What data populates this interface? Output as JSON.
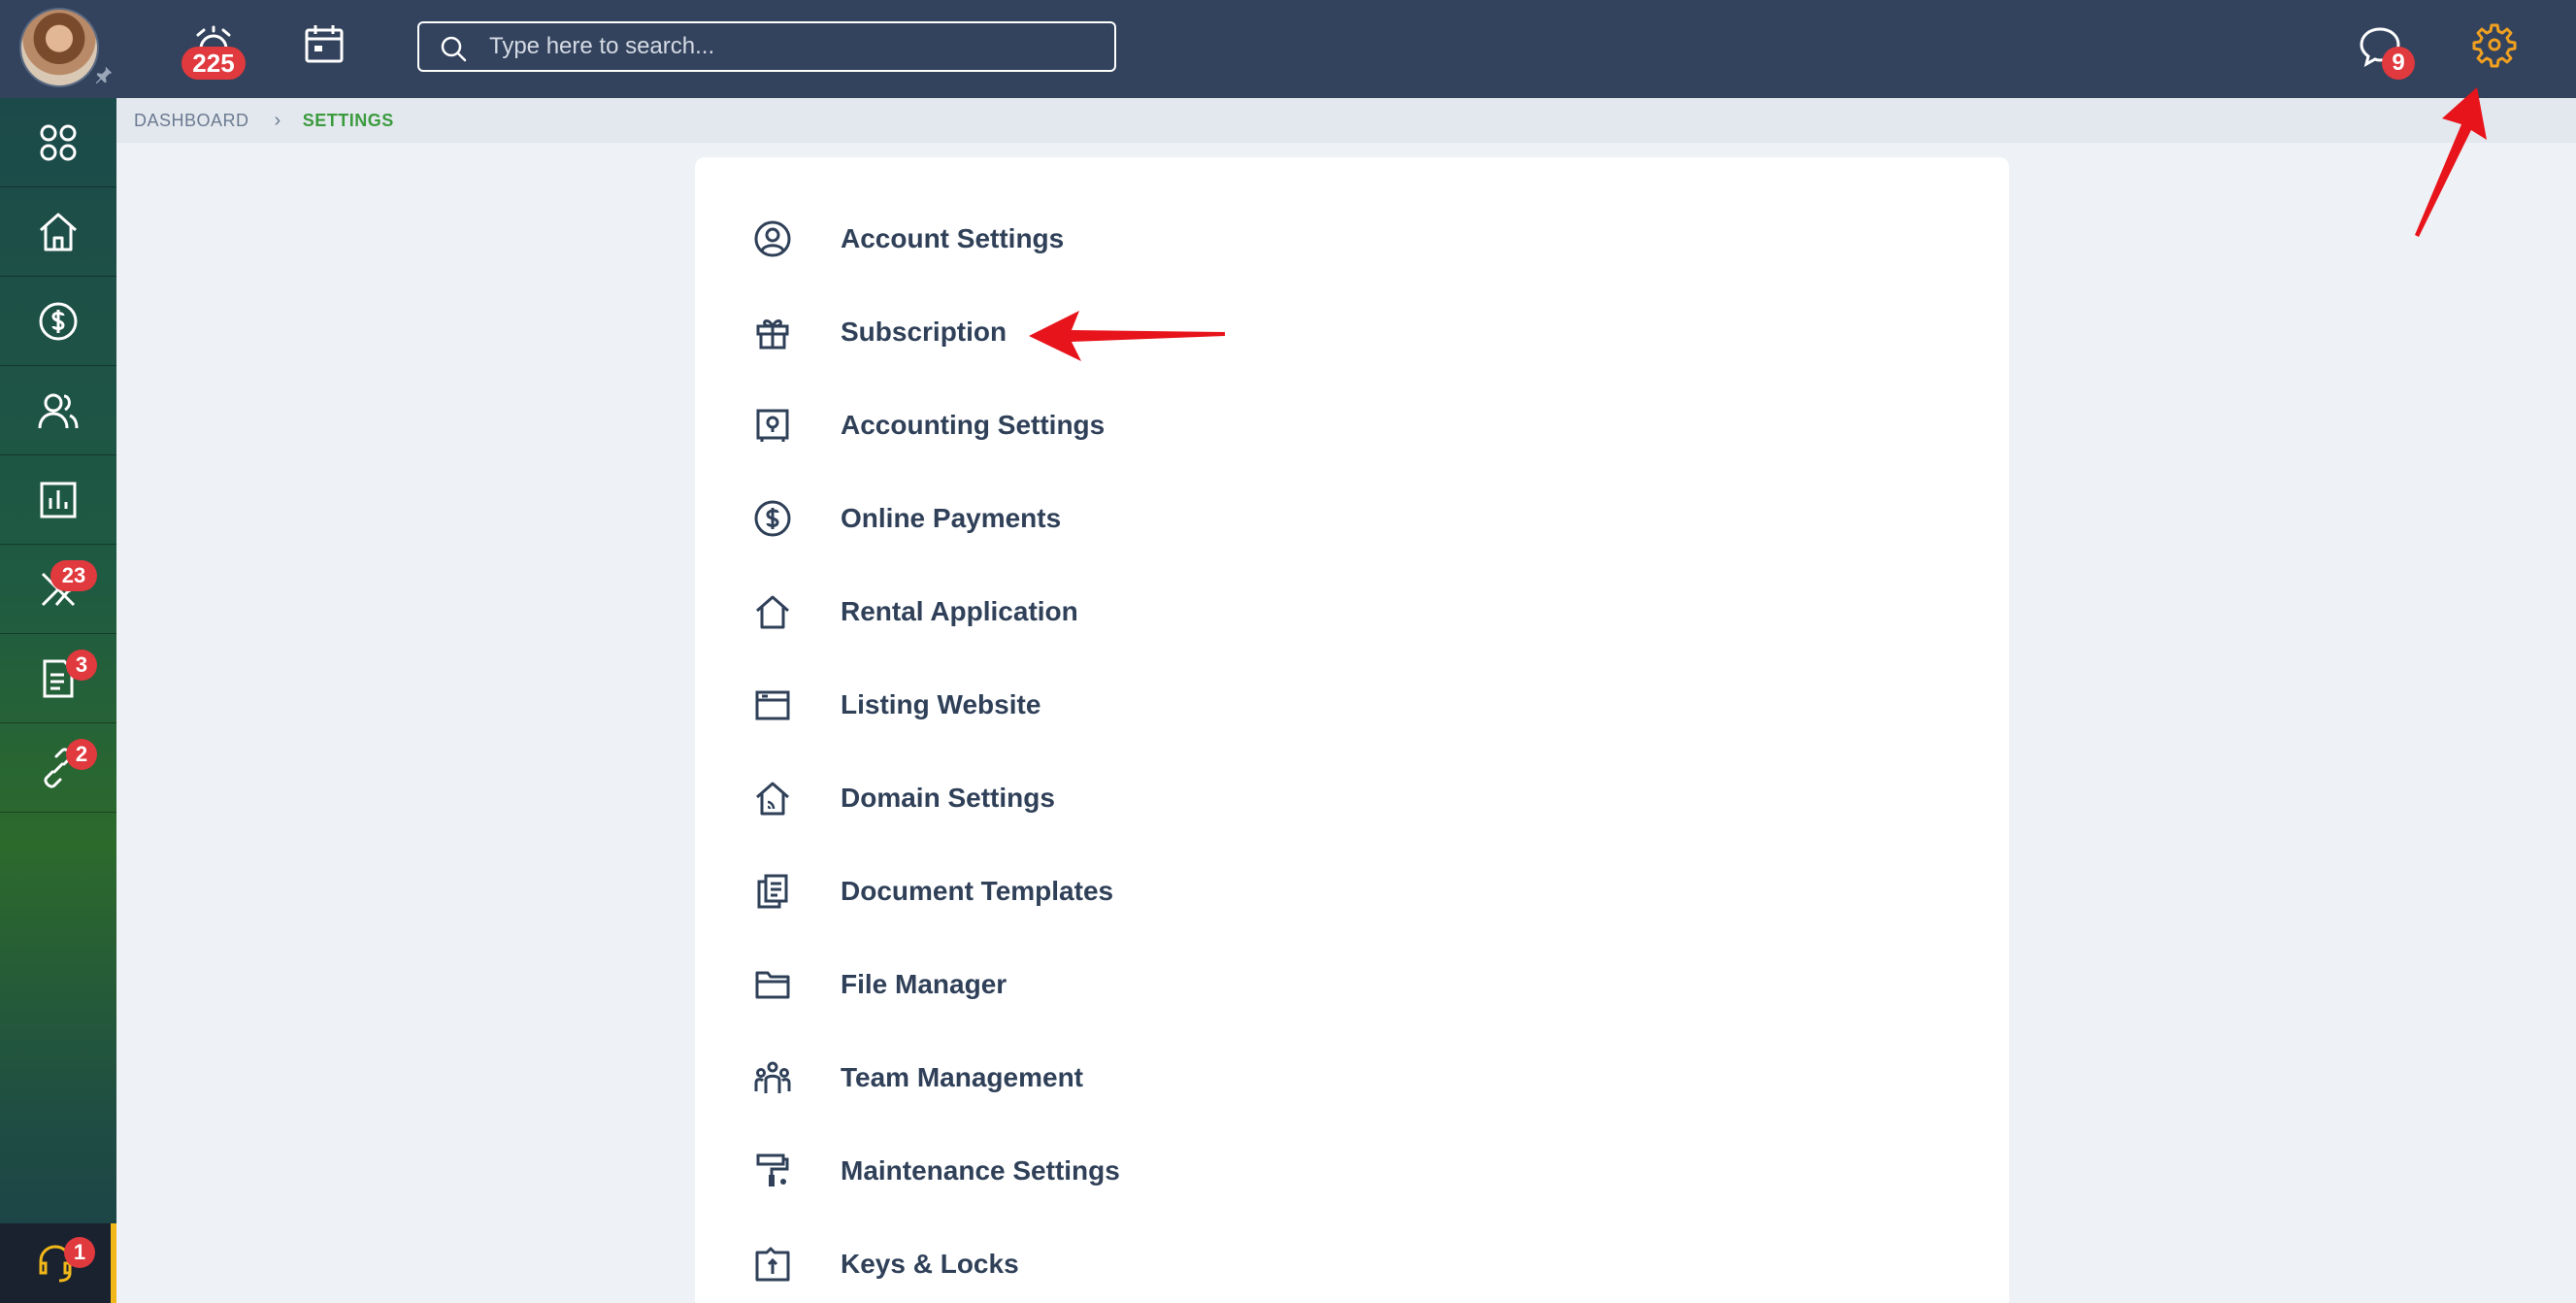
{
  "topbar": {
    "alerts_badge": "225",
    "messages_badge": "9",
    "search": {
      "placeholder": "Type here to search..."
    }
  },
  "sidebar": {
    "badges": {
      "maintenance": "23",
      "documents": "3",
      "links": "2",
      "support": "1"
    }
  },
  "breadcrumb": {
    "items": [
      "DASHBOARD",
      "SETTINGS"
    ]
  },
  "settings_menu": {
    "items": [
      {
        "label": "Account Settings",
        "icon": "user-circle-icon"
      },
      {
        "label": "Subscription",
        "icon": "gift-icon"
      },
      {
        "label": "Accounting Settings",
        "icon": "safe-icon"
      },
      {
        "label": "Online Payments",
        "icon": "dollar-circle-icon"
      },
      {
        "label": "Rental Application",
        "icon": "home-icon"
      },
      {
        "label": "Listing Website",
        "icon": "browser-window-icon"
      },
      {
        "label": "Domain Settings",
        "icon": "home-signal-icon"
      },
      {
        "label": "Document Templates",
        "icon": "documents-icon"
      },
      {
        "label": "File Manager",
        "icon": "folder-icon"
      },
      {
        "label": "Team Management",
        "icon": "team-icon"
      },
      {
        "label": "Maintenance Settings",
        "icon": "paint-roller-icon"
      },
      {
        "label": "Keys & Locks",
        "icon": "key-box-icon"
      }
    ]
  },
  "colors": {
    "topbar": "#33435d",
    "badge": "#e0393e",
    "active_breadcrumb": "#3c9b3f",
    "gear": "#f0a020",
    "annotation_arrow": "#e8141b"
  }
}
